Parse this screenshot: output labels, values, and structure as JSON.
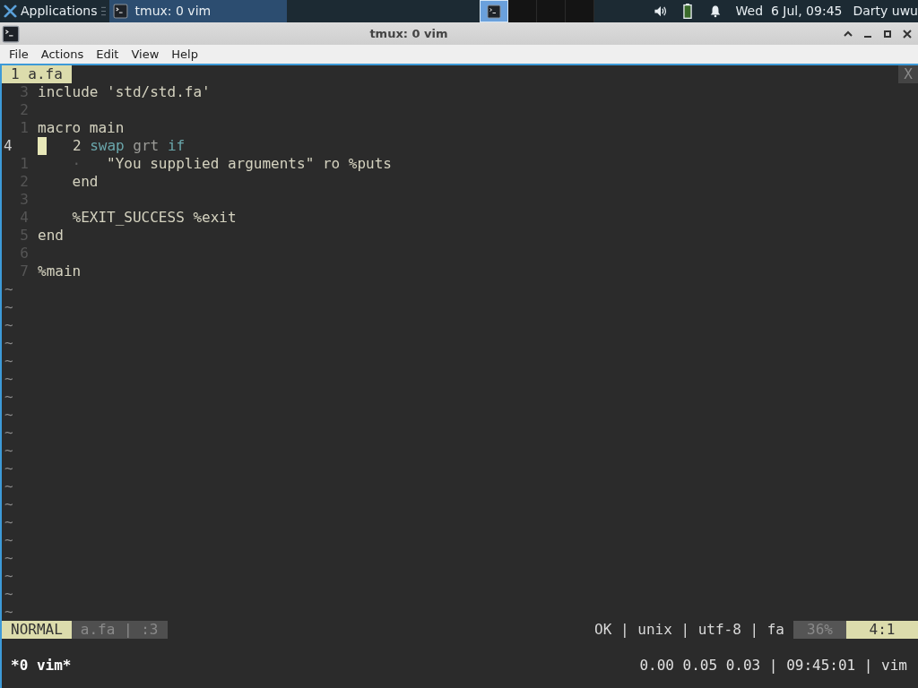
{
  "taskbar": {
    "apps_menu": "Applications",
    "tasks": [
      {
        "title": "tmux: 0 vim",
        "selected": true
      }
    ],
    "workspaces": [
      {
        "selected": true,
        "has_window": true
      },
      {
        "selected": false,
        "has_window": false
      },
      {
        "selected": false,
        "has_window": false
      },
      {
        "selected": false,
        "has_window": false
      }
    ],
    "clock": "Wed  6 Jul, 09:45",
    "user": "Darty uwu"
  },
  "window": {
    "title": "tmux: 0 vim",
    "menu": [
      "File",
      "Actions",
      "Edit",
      "View",
      "Help"
    ]
  },
  "editor": {
    "tabs": [
      {
        "label": "1 a.fa",
        "selected": true
      }
    ],
    "close_label": "X",
    "lines": [
      {
        "number": "3",
        "current": false,
        "segments": [
          {
            "text": "include 'std/std.fa'",
            "kind": "plain"
          }
        ]
      },
      {
        "number": "2",
        "current": false
      },
      {
        "number": "1",
        "current": false,
        "segments": [
          {
            "text": "macro main",
            "kind": "plain"
          }
        ]
      },
      {
        "number": "4",
        "current": true,
        "segments": [
          {
            "text": "   2 ",
            "kind": "plain"
          },
          {
            "text": "swap ",
            "kind": "keyword"
          },
          {
            "text": "grt ",
            "kind": "builtin"
          },
          {
            "text": "if",
            "kind": "keyword"
          }
        ]
      },
      {
        "number": "1",
        "current": false,
        "segments": [
          {
            "text": "    ·",
            "kind": "dim"
          },
          {
            "text": "   \"You supplied arguments\" ro %puts",
            "kind": "plain"
          }
        ]
      },
      {
        "number": "2",
        "current": false,
        "segments": [
          {
            "text": "    end",
            "kind": "plain"
          }
        ]
      },
      {
        "number": "3",
        "current": false
      },
      {
        "number": "4",
        "current": false,
        "segments": [
          {
            "text": "    %EXIT_SUCCESS %exit",
            "kind": "plain"
          }
        ]
      },
      {
        "number": "5",
        "current": false,
        "segments": [
          {
            "text": "end",
            "kind": "plain"
          }
        ]
      },
      {
        "number": "6",
        "current": false
      },
      {
        "number": "7",
        "current": false,
        "segments": [
          {
            "text": "%main",
            "kind": "plain"
          }
        ]
      }
    ],
    "filler": [
      "~",
      "~",
      "~",
      "~",
      "~",
      "~",
      "~",
      "~",
      "~",
      "~",
      "~",
      "~",
      "~",
      "~",
      "~",
      "~",
      "~",
      "~",
      "~"
    ],
    "status": {
      "mode": "NORMAL",
      "file_info": "a.fa | :3",
      "file_meta": "OK | unix | utf-8 | fa",
      "percent": "36%",
      "position": "4:1"
    }
  },
  "tmux": {
    "windows": [
      {
        "label": "*0 vim*",
        "selected": true
      }
    ],
    "status": "0.00 0.05 0.03 | 09:45:01 | vim"
  }
}
